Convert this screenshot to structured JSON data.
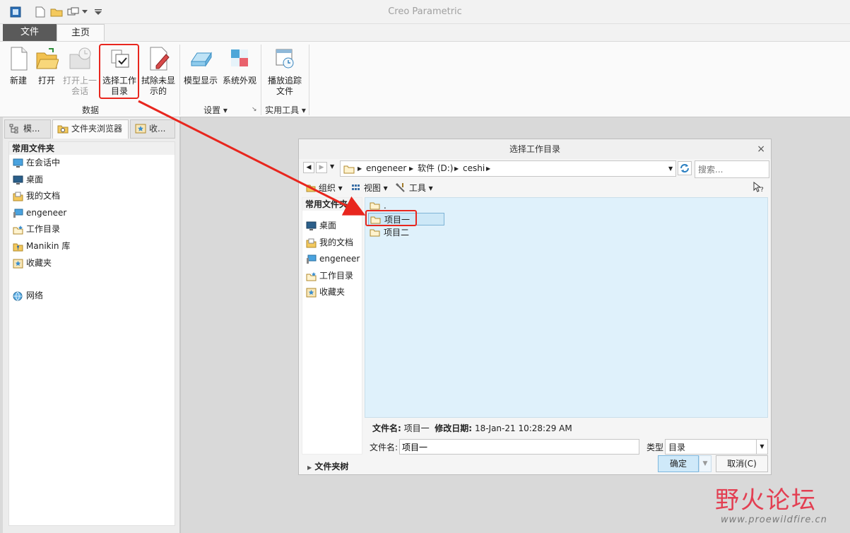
{
  "app": {
    "title": "Creo Parametric"
  },
  "ribbon": {
    "tabs": [
      "文件",
      "主页"
    ],
    "buttons": {
      "new": "新建",
      "open": "打开",
      "open_last_1": "打开上一",
      "open_last_2": "会话",
      "select_dir_1": "选择工作",
      "select_dir_2": "目录",
      "erase_1": "拭除未显",
      "erase_2": "示的",
      "model_display": "模型显示",
      "sys_appearance": "系统外观",
      "play_trail_1": "播放追踪",
      "play_trail_2": "文件"
    },
    "groups": {
      "data": "数据",
      "settings": "设置 ▾",
      "utilities": "实用工具 ▾"
    }
  },
  "navigator": {
    "tabs": [
      "模...",
      "文件夹浏览器",
      "收..."
    ],
    "header": "常用文件夹",
    "items": [
      "在会话中",
      "桌面",
      "我的文档",
      "engeneer",
      "工作目录",
      "Manikin 库",
      "收藏夹",
      "网络"
    ]
  },
  "dialog": {
    "title": "选择工作目录",
    "close": "×",
    "path": [
      "engeneer",
      "软件 (D:)",
      "ceshi"
    ],
    "search_placeholder": "搜索...",
    "tools": {
      "organize": "组织 ▾",
      "view": "视图 ▾",
      "tools": "工具 ▾"
    },
    "left_header": "常用文件夹",
    "left_items": [
      "桌面",
      "我的文档",
      "engeneer",
      "工作目录",
      "收藏夹"
    ],
    "files": [
      ".",
      "项目一",
      "项目二"
    ],
    "selected_file": "项目一",
    "info": {
      "name_label": "文件名:",
      "name_value": "项目一",
      "date_label": "修改日期:",
      "date_value": "18-Jan-21 10:28:29 AM"
    },
    "filename_label": "文件名:",
    "filename_value": "项目一",
    "type_label": "类型",
    "type_value": "目录",
    "folder_tree": "文件夹树",
    "ok": "确定",
    "cancel": "取消(C)"
  },
  "watermark": {
    "text": "野火论坛",
    "url": "www.proewildfire.cn"
  },
  "colors": {
    "highlight": "#e8261e",
    "file_list_bg": "#dff1fb",
    "watermark": "#e33f52"
  }
}
